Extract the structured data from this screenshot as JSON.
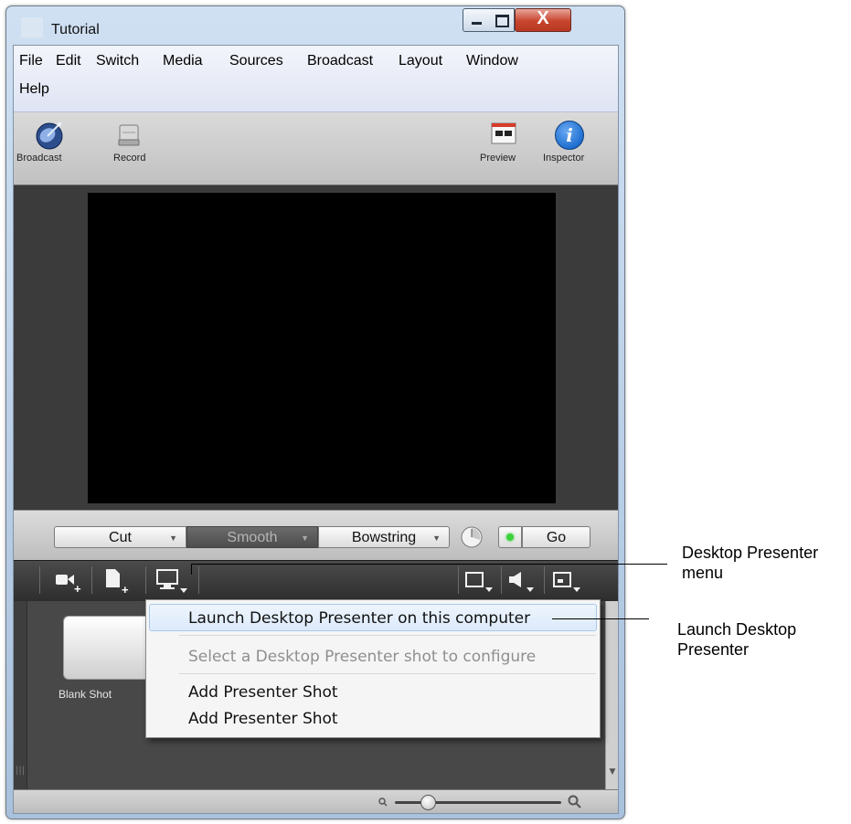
{
  "window": {
    "title": "Tutorial",
    "close_glyph": "X"
  },
  "menubar": {
    "items": [
      "File",
      "Edit",
      "Switch",
      "Media",
      "Sources",
      "Broadcast",
      "Layout",
      "Window",
      "Help"
    ]
  },
  "toolbar": {
    "broadcast_label": "Broadcast",
    "record_label": "Record",
    "preview_label": "Preview",
    "inspector_label": "Inspector",
    "inspector_glyph": "i"
  },
  "transitions": {
    "cut": "Cut",
    "smooth": "Smooth",
    "bowstring": "Bowstring",
    "go": "Go"
  },
  "shots": {
    "blank_shot_label": "Blank Shot"
  },
  "presenter_menu": {
    "launch": "Launch Desktop Presenter on this computer",
    "configure": "Select a Desktop Presenter shot to configure",
    "add_1": "Add Presenter Shot",
    "add_2": "Add Presenter Shot"
  },
  "callouts": {
    "desktop_presenter_menu": "Desktop Presenter menu",
    "launch_desktop_presenter": "Launch Desktop Presenter"
  },
  "colors": {
    "accent_blue": "#1f6fd0",
    "go_led": "#3bd23b",
    "menu_highlight": "#dceafb"
  }
}
